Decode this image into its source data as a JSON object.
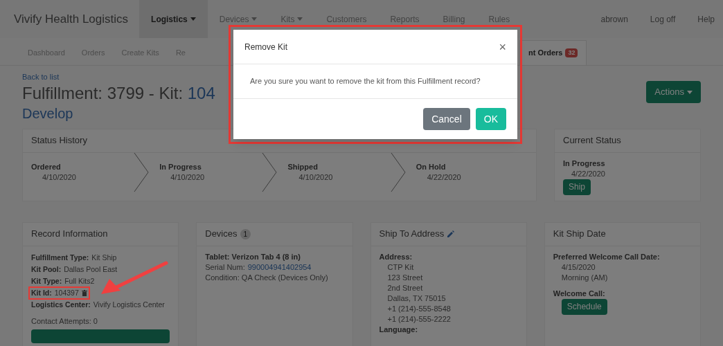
{
  "brand": "Vivify Health Logistics",
  "nav": [
    {
      "label": "Logistics",
      "dropdown": true,
      "selected": true
    },
    {
      "label": "Devices",
      "dropdown": true,
      "selected": false
    },
    {
      "label": "Kits",
      "dropdown": true,
      "selected": false
    },
    {
      "label": "Customers",
      "dropdown": false,
      "selected": false
    },
    {
      "label": "Reports",
      "dropdown": false,
      "selected": false
    },
    {
      "label": "Billing",
      "dropdown": false,
      "selected": false
    },
    {
      "label": "Rules",
      "dropdown": false,
      "selected": false
    }
  ],
  "user_links": [
    "abrown",
    "Log off",
    "Help"
  ],
  "tabs": [
    {
      "label": "Dashboard",
      "selected": false
    },
    {
      "label": "Orders",
      "selected": false
    },
    {
      "label": "Create Kits",
      "selected": false
    },
    {
      "label": "Re",
      "selected": false
    },
    {
      "label": "nt Orders",
      "badge": "32",
      "selected": true
    }
  ],
  "page": {
    "back_link": "Back to list",
    "title": "Fulfillment: 3799 - Kit: ",
    "title_link": "104",
    "subtitle": "Develop",
    "actions": "Actions"
  },
  "status_history": {
    "title": "Status History",
    "steps": [
      {
        "name": "Ordered",
        "date": "4/10/2020"
      },
      {
        "name": "In Progress",
        "date": "4/10/2020"
      },
      {
        "name": "Shipped",
        "date": "4/10/2020"
      },
      {
        "name": "On Hold",
        "date": "4/22/2020"
      }
    ]
  },
  "current_status": {
    "title": "Current Status",
    "status": "In Progress",
    "date": "4/22/2020",
    "button": "Ship"
  },
  "record_information": {
    "title": "Record Information",
    "fields": [
      {
        "label": "Fulfillment Type:",
        "value": "Kit Ship",
        "removable": false
      },
      {
        "label": "Kit Pool:",
        "value": "Dallas Pool East",
        "removable": false
      },
      {
        "label": "Kit Type:",
        "value": "Full Kits2",
        "removable": false
      },
      {
        "label": "Kit Id:",
        "value": "104397",
        "removable": true
      },
      {
        "label": "Logistics Center:",
        "value": "Vivify Logistics Center",
        "removable": false
      }
    ],
    "contact_attempts": "Contact Attempts: 0"
  },
  "devices": {
    "title": "Devices",
    "count": "1",
    "device": "Tablet: Verizon Tab 4 (8 in)",
    "serial_label": "Serial Num:",
    "serial": "990004941402954",
    "condition": "Condition: QA Check (Devices Only)"
  },
  "ship_to": {
    "title": "Ship To Address",
    "address_label": "Address:",
    "lines": [
      "CTP Kit",
      "123 Street",
      "2nd Street",
      "Dallas, TX 75015",
      "+1 (214)-555-8548",
      "+1 (214)-555-2222"
    ],
    "language_label": "Language:"
  },
  "kit_ship_date": {
    "title": "Kit Ship Date",
    "preferred_label": "Preferred Welcome Call Date:",
    "date": "4/15/2020",
    "time": "Morning (AM)",
    "welcome_label": "Welcome Call:",
    "button": "Schedule"
  },
  "modal": {
    "title": "Remove Kit",
    "close": "×",
    "message": "Are you sure you want to remove the kit from this Fulfillment record?",
    "buttons": [
      {
        "label": "Cancel",
        "kind": "secondary"
      },
      {
        "label": "OK",
        "kind": "primary"
      }
    ]
  }
}
